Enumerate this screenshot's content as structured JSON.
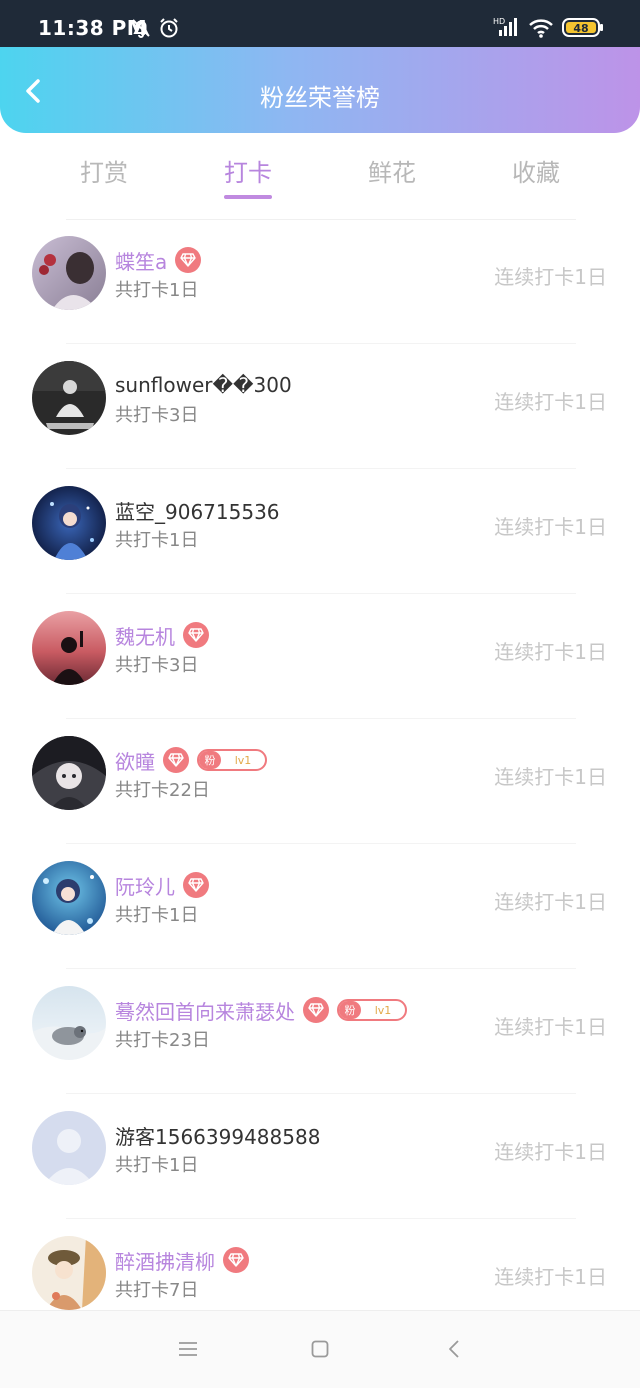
{
  "status_bar": {
    "time": "11:38 PM",
    "hd_label": "HD",
    "battery": "48"
  },
  "header": {
    "title": "粉丝荣誉榜"
  },
  "tabs": [
    {
      "label": "打赏",
      "active": false
    },
    {
      "label": "打卡",
      "active": true
    },
    {
      "label": "鲜花",
      "active": false
    },
    {
      "label": "收藏",
      "active": false
    }
  ],
  "colors": {
    "accent": "#b785de",
    "badge": "#f07a7f",
    "status_bar": "#1f2a38"
  },
  "fans": [
    {
      "name": "蝶笙a",
      "vip": true,
      "fan_level": null,
      "total": "共打卡1日",
      "streak": "连续打卡1日"
    },
    {
      "name": "sunflower��300",
      "vip": false,
      "fan_level": null,
      "total": "共打卡3日",
      "streak": "连续打卡1日"
    },
    {
      "name": "蓝空_906715536",
      "vip": false,
      "fan_level": null,
      "total": "共打卡1日",
      "streak": "连续打卡1日"
    },
    {
      "name": "魏无机",
      "vip": true,
      "fan_level": null,
      "total": "共打卡3日",
      "streak": "连续打卡1日"
    },
    {
      "name": "欲瞳",
      "vip": true,
      "fan_level": "lv1",
      "total": "共打卡22日",
      "streak": "连续打卡1日"
    },
    {
      "name": "阮玲儿",
      "vip": true,
      "fan_level": null,
      "total": "共打卡1日",
      "streak": "连续打卡1日"
    },
    {
      "name": "蓦然回首向来萧瑟处",
      "vip": true,
      "fan_level": "lv1",
      "total": "共打卡23日",
      "streak": "连续打卡1日"
    },
    {
      "name": "游客1566399488588",
      "vip": false,
      "fan_level": null,
      "total": "共打卡1日",
      "streak": "连续打卡1日"
    },
    {
      "name": "醉酒拂清柳",
      "vip": true,
      "fan_level": null,
      "total": "共打卡7日",
      "streak": "连续打卡1日"
    }
  ],
  "fan_badge_label": "粉"
}
